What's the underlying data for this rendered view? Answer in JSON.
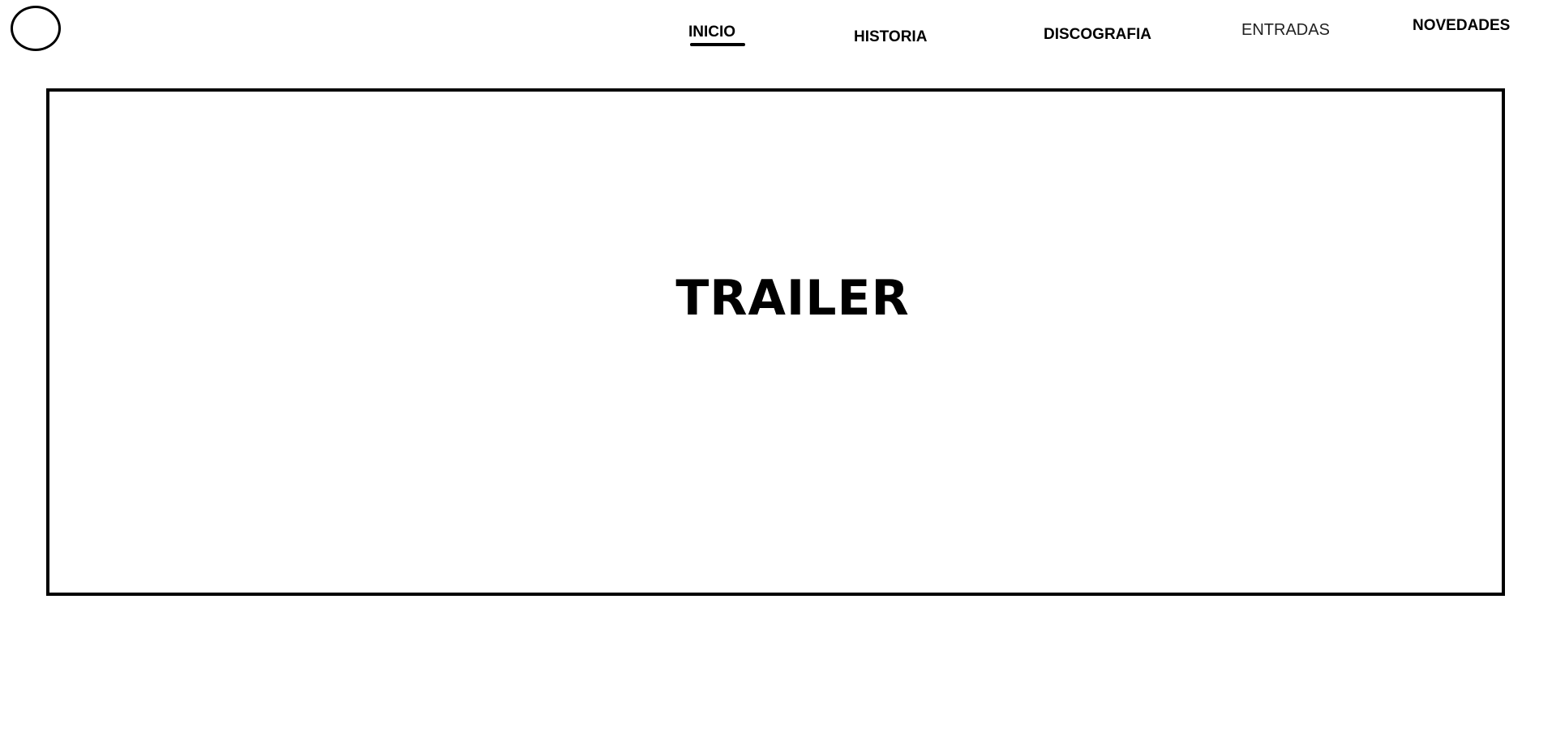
{
  "header": {
    "logo_icon": "circle-logo-icon",
    "nav": {
      "inicio": "INICIO",
      "historia": "HISTORIA",
      "discografia": "DISCOGRAFIA",
      "entradas": "ENTRADAS",
      "novedades": "NOVEDADES"
    },
    "active_item": "INICIO"
  },
  "main": {
    "trailer_label": "TRAILER"
  }
}
